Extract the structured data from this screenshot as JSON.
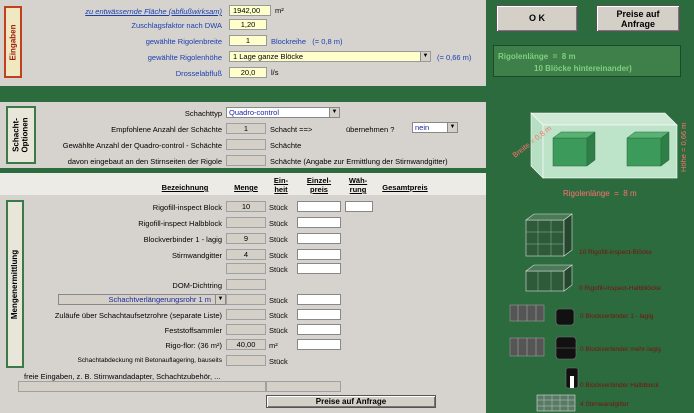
{
  "inputs_panel": {
    "tab_label": "Eingaben",
    "rows": [
      {
        "label": "zu entwässernde Fläche (abflußwirksam)",
        "value": "1942,00",
        "unit": "m²"
      },
      {
        "label": "Zuschlagsfaktor nach DWA",
        "value": "1,20",
        "unit": ""
      },
      {
        "label": "gewählte Rigolenbreite",
        "value": "1",
        "unit": "Blockreihe   (= 0,8 m)"
      },
      {
        "label": "gewählte Rigolenhöhe",
        "value": "1 Lage ganze Blöcke",
        "unit": "(= 0,66 m)"
      },
      {
        "label": "Drosselabfluß",
        "value": "20,0",
        "unit": "l/s"
      }
    ]
  },
  "buttons": {
    "ok": "O K",
    "quote_top_line1": "Preise auf",
    "quote_top_line2": "Anfrage",
    "quote_bottom": "Preise auf Anfrage"
  },
  "result_box": {
    "line1": "Rigolenlänge  =  8 m",
    "line2": "10 Blöcke hintereinander)"
  },
  "shaft_panel": {
    "tab_label_1": "Schacht-",
    "tab_label_2": "Optionen",
    "type_label": "Schachttyp",
    "type_value": "Quadro-control",
    "recommended_label": "Empfohlene Anzahl der Schächte",
    "recommended_value": "1",
    "recommended_suffix": "Schacht ==>",
    "accept_label": "übernehmen ?",
    "accept_value": "nein",
    "chosen_label": "Gewählte Anzahl der Quadro-control - Schächte",
    "chosen_suffix": "Schächte",
    "face_label": "davon eingebaut an den Stirnseiten der Rigole",
    "face_suffix": "Schächte (Angabe zur Ermittlung der Stirnwandgitter)"
  },
  "quantities_panel": {
    "tab_label": "Mengenermittlung",
    "headers": {
      "designation": "Bezeichnung",
      "quantity": "Menge",
      "unit_1": "Ein-",
      "unit_2": "heit",
      "unit_price_1": "Einzel-",
      "unit_price_2": "preis",
      "currency_1": "Wäh-",
      "currency_2": "rung",
      "total_price": "Gesamtpreis"
    },
    "rows": [
      {
        "name": "Rigofill-inspect Block",
        "qty": "10",
        "unit": "Stück"
      },
      {
        "name": "Rigofill-inspect Halbblock",
        "qty": "",
        "unit": "Stück"
      },
      {
        "name": "Blockverbinder 1 - lagig",
        "qty": "9",
        "unit": "Stück"
      },
      {
        "name": "Stirnwandgitter",
        "qty": "4",
        "unit": "Stück"
      },
      {
        "name": "",
        "qty": "",
        "unit": "Stück"
      },
      {
        "name": "DOM-Dichtring",
        "qty": "",
        "unit": ""
      },
      {
        "name": "Schachtverlängerungsrohr 1 m",
        "qty": "",
        "unit": "Stück"
      },
      {
        "name": "Zuläufe über Schachtaufsetzrohre (separate Liste)",
        "qty": "",
        "unit": "Stück"
      },
      {
        "name": "Feststoffsammler",
        "qty": "",
        "unit": "Stück"
      },
      {
        "name": "Rigo-flor: (36 m²)",
        "qty": "40,00",
        "unit": "m²"
      },
      {
        "name": "Schachtabdeckung mit Betonauflagering, bauseits",
        "qty": "",
        "unit": "Stück"
      }
    ],
    "free_input_label": "freie Eingaben, z. B. Stirnwandadapter, Schachtzubehör, ..."
  },
  "diagram": {
    "width_label": "Breite = 0,8 m",
    "height_label": "Höhe = 0,66 m",
    "length_label": "Rigolenlänge  =  8 m"
  },
  "products": [
    {
      "label": "10 Rigofill-inspect-Blöcke"
    },
    {
      "label": "0 Rigofill-inspect-Halbblöcke"
    },
    {
      "label": "0 Blockverbinder 1 - lagig"
    },
    {
      "label": "0 Blockverbinder mehr-lagig"
    },
    {
      "label": "0 Blockverbinder Halbblock"
    },
    {
      "label": "4 Stirnwandgitter"
    }
  ],
  "colors": {
    "background_green": "#2c6b3e",
    "panel_gray": "#d6d3ce",
    "yellow_input": "#ffffcc",
    "result_green": "#3f7f4a",
    "label_blue": "#1a3fb0"
  }
}
